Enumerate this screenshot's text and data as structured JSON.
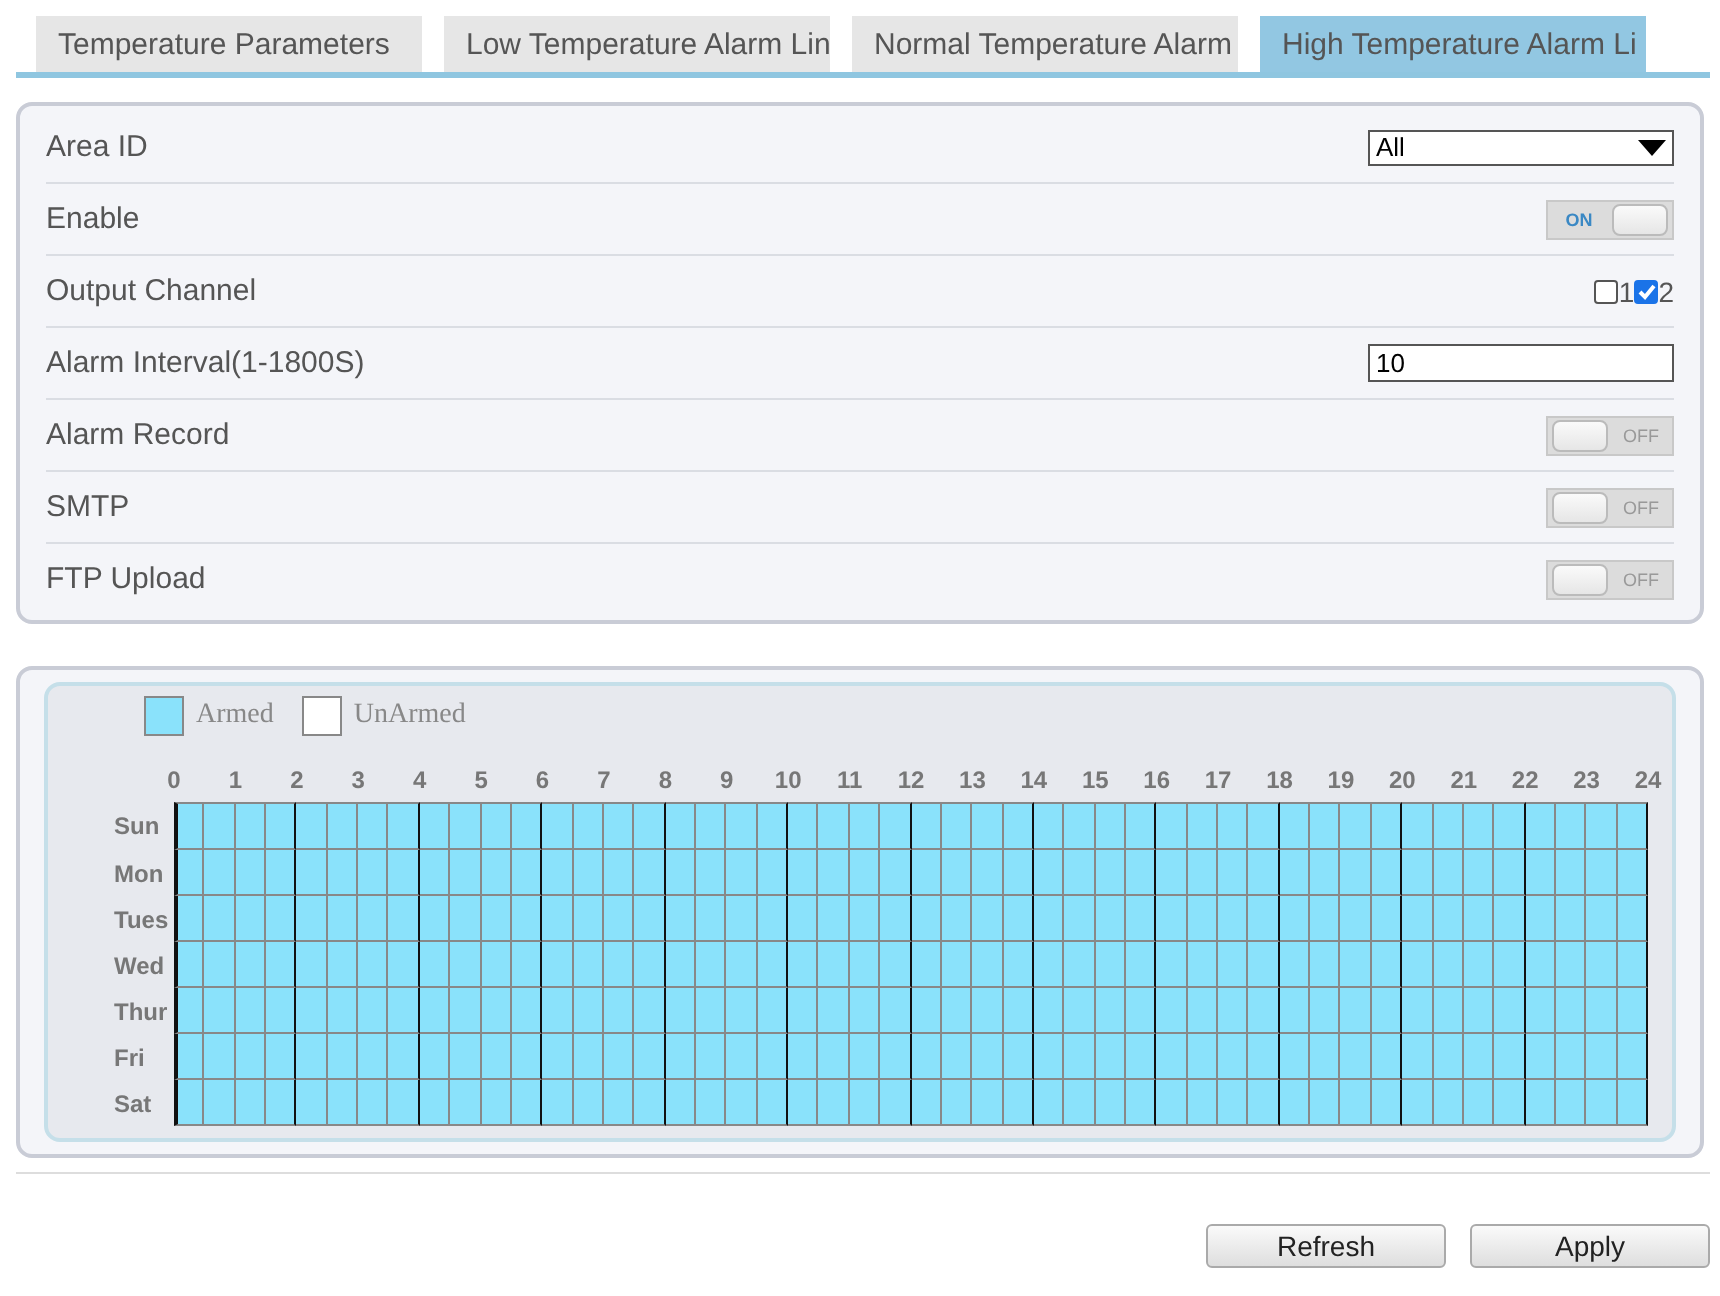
{
  "tabs": [
    {
      "label": "Temperature Parameters",
      "selected": false
    },
    {
      "label": "Low Temperature Alarm Lin",
      "selected": false
    },
    {
      "label": "Normal Temperature Alarm",
      "selected": false
    },
    {
      "label": "High Temperature Alarm Li",
      "selected": true
    }
  ],
  "settings": [
    {
      "kind": "select",
      "label": "Area ID",
      "value": "All"
    },
    {
      "kind": "switch",
      "label": "Enable",
      "on": true,
      "text": "ON"
    },
    {
      "kind": "checkboxes",
      "label": "Output Channel",
      "options": [
        {
          "label": "1",
          "checked": false
        },
        {
          "label": "2",
          "checked": true
        }
      ]
    },
    {
      "kind": "text",
      "label": "Alarm Interval(1-1800S)",
      "value": "10"
    },
    {
      "kind": "switch",
      "label": "Alarm Record",
      "on": false,
      "text": "OFF"
    },
    {
      "kind": "switch",
      "label": "SMTP",
      "on": false,
      "text": "OFF"
    },
    {
      "kind": "switch",
      "label": "FTP Upload",
      "on": false,
      "text": "OFF"
    }
  ],
  "schedule": {
    "legend": [
      {
        "label": "Armed",
        "color": "#8ae2fb"
      },
      {
        "label": "UnArmed",
        "color": "#ffffff"
      }
    ],
    "hours": [
      "0",
      "1",
      "2",
      "3",
      "4",
      "5",
      "6",
      "7",
      "8",
      "9",
      "10",
      "11",
      "12",
      "13",
      "14",
      "15",
      "16",
      "17",
      "18",
      "19",
      "20",
      "21",
      "22",
      "23",
      "24"
    ],
    "days": [
      {
        "label": "Sun",
        "armed": [
          true,
          true,
          true,
          true,
          true,
          true,
          true,
          true,
          true,
          true,
          true,
          true,
          true,
          true,
          true,
          true,
          true,
          true,
          true,
          true,
          true,
          true,
          true,
          true,
          true,
          true,
          true,
          true,
          true,
          true,
          true,
          true,
          true,
          true,
          true,
          true,
          true,
          true,
          true,
          true,
          true,
          true,
          true,
          true,
          true,
          true,
          true,
          true
        ]
      },
      {
        "label": "Mon",
        "armed": [
          true,
          true,
          true,
          true,
          true,
          true,
          true,
          true,
          true,
          true,
          true,
          true,
          true,
          true,
          true,
          true,
          true,
          true,
          true,
          true,
          true,
          true,
          true,
          true,
          true,
          true,
          true,
          true,
          true,
          true,
          true,
          true,
          true,
          true,
          true,
          true,
          true,
          true,
          true,
          true,
          true,
          true,
          true,
          true,
          true,
          true,
          true,
          true
        ]
      },
      {
        "label": "Tues",
        "armed": [
          true,
          true,
          true,
          true,
          true,
          true,
          true,
          true,
          true,
          true,
          true,
          true,
          true,
          true,
          true,
          true,
          true,
          true,
          true,
          true,
          true,
          true,
          true,
          true,
          true,
          true,
          true,
          true,
          true,
          true,
          true,
          true,
          true,
          true,
          true,
          true,
          true,
          true,
          true,
          true,
          true,
          true,
          true,
          true,
          true,
          true,
          true,
          true
        ]
      },
      {
        "label": "Wed",
        "armed": [
          true,
          true,
          true,
          true,
          true,
          true,
          true,
          true,
          true,
          true,
          true,
          true,
          true,
          true,
          true,
          true,
          true,
          true,
          true,
          true,
          true,
          true,
          true,
          true,
          true,
          true,
          true,
          true,
          true,
          true,
          true,
          true,
          true,
          true,
          true,
          true,
          true,
          true,
          true,
          true,
          true,
          true,
          true,
          true,
          true,
          true,
          true,
          true
        ]
      },
      {
        "label": "Thur",
        "armed": [
          true,
          true,
          true,
          true,
          true,
          true,
          true,
          true,
          true,
          true,
          true,
          true,
          true,
          true,
          true,
          true,
          true,
          true,
          true,
          true,
          true,
          true,
          true,
          true,
          true,
          true,
          true,
          true,
          true,
          true,
          true,
          true,
          true,
          true,
          true,
          true,
          true,
          true,
          true,
          true,
          true,
          true,
          true,
          true,
          true,
          true,
          true,
          true
        ]
      },
      {
        "label": "Fri",
        "armed": [
          true,
          true,
          true,
          true,
          true,
          true,
          true,
          true,
          true,
          true,
          true,
          true,
          true,
          true,
          true,
          true,
          true,
          true,
          true,
          true,
          true,
          true,
          true,
          true,
          true,
          true,
          true,
          true,
          true,
          true,
          true,
          true,
          true,
          true,
          true,
          true,
          true,
          true,
          true,
          true,
          true,
          true,
          true,
          true,
          true,
          true,
          true,
          true
        ]
      },
      {
        "label": "Sat",
        "armed": [
          true,
          true,
          true,
          true,
          true,
          true,
          true,
          true,
          true,
          true,
          true,
          true,
          true,
          true,
          true,
          true,
          true,
          true,
          true,
          true,
          true,
          true,
          true,
          true,
          true,
          true,
          true,
          true,
          true,
          true,
          true,
          true,
          true,
          true,
          true,
          true,
          true,
          true,
          true,
          true,
          true,
          true,
          true,
          true,
          true,
          true,
          true,
          true
        ]
      }
    ]
  },
  "buttons": [
    "Refresh",
    "Apply"
  ]
}
